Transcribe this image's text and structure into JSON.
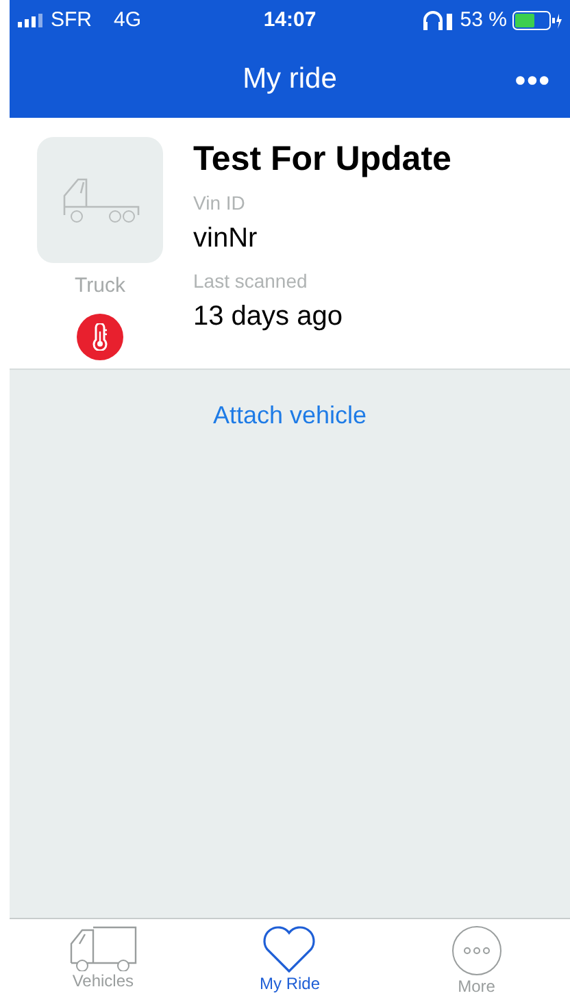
{
  "status_bar": {
    "carrier": "SFR",
    "network": "4G",
    "time": "14:07",
    "battery": "53 %"
  },
  "header": {
    "title": "My ride",
    "menu": "•••"
  },
  "vehicle": {
    "name": "Test For Update",
    "type": "Truck",
    "vin_label": "Vin ID",
    "vin": "vinNr",
    "scanned_label": "Last scanned",
    "scanned": "13 days ago",
    "alert": true
  },
  "attach": "Attach vehicle",
  "tabs": [
    {
      "label": "Vehicles",
      "kind": "truck",
      "selected": false
    },
    {
      "label": "My Ride",
      "kind": "heart",
      "selected": true
    },
    {
      "label": "More",
      "kind": "more",
      "selected": false
    }
  ]
}
